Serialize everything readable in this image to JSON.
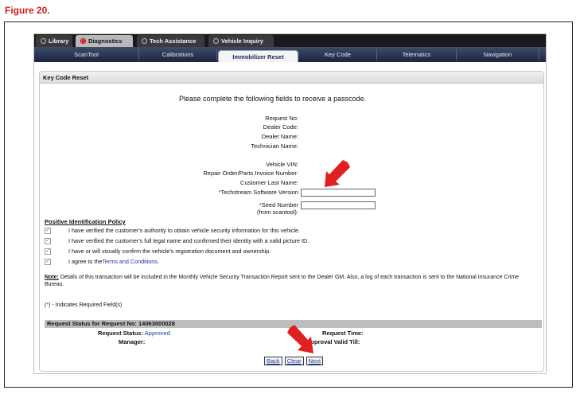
{
  "figure": {
    "title": "Figure 20."
  },
  "top_tabs": [
    {
      "label": "Library",
      "active": false
    },
    {
      "label": "Diagnostics",
      "active": true
    },
    {
      "label": "Tech Assistance",
      "active": false
    },
    {
      "label": "Vehicle Inquiry",
      "active": false
    }
  ],
  "sub_tabs": [
    {
      "label": "ScanTool",
      "active": false
    },
    {
      "label": "Calibrations",
      "active": false
    },
    {
      "label": "Immobilizer Reset",
      "active": true
    },
    {
      "label": "Key Code",
      "active": false
    },
    {
      "label": "Telematics",
      "active": false
    },
    {
      "label": "Navigation",
      "active": false
    }
  ],
  "panel": {
    "title": "Key Code Reset"
  },
  "form": {
    "intro": "Please complete the following fields to receive a passcode.",
    "labels": {
      "request_no": "Request No:",
      "dealer_code": "Dealer Code:",
      "dealer_name": "Dealer Name:",
      "technician_name": "Technician Name:",
      "vehicle_vin": "Vehicle VIN:",
      "repair_order": "Repair Order/Parts Invoice Number:",
      "customer_last_name": "Customer Last Name:",
      "techstream_version": "Techstream Software Version",
      "seed_number": "Seed Number",
      "seed_number_sub": "(from scantool):"
    },
    "required_mark": "*",
    "techstream_value": "",
    "seed_value": ""
  },
  "policy": {
    "title": "Positive Identification Policy",
    "items": [
      {
        "text": "I have verified the customer's authority to obtain vehicle security information for this vehicle.",
        "checked": true
      },
      {
        "text": "I have verified the customer's full legal name and confirmed their identity with a valid picture ID.",
        "checked": true
      },
      {
        "text": "I have or will visually confirm the vehicle's registration document and ownership.",
        "checked": true
      },
      {
        "text_prefix": "I agree to the ",
        "link": "Terms and Conditions",
        "text_suffix": ".",
        "checked": true
      }
    ],
    "check_glyph": "✓"
  },
  "note": {
    "label": "Note:",
    "text": " Details of this transaction will be included in the Monthly Vehicle Security Transaction Report sent to the Dealer GM. Also, a log of each transaction is sent to the National Insurance Crime Bureau."
  },
  "legend": {
    "open": "(",
    "mark": "*",
    "close": ") - Indicates Required Field(s)"
  },
  "status": {
    "header": "Request Status for Request No: 14063000028",
    "request_status_label": "Request Status:",
    "request_status_value": "Approved",
    "manager_label": "Manager:",
    "request_time_label": "Request Time:",
    "approval_valid_label": "Approval Valid Till:"
  },
  "buttons": {
    "back": "Back",
    "clear": "Clear",
    "next": "Next"
  },
  "colors": {
    "figure_title": "#d21e1e",
    "arrow": "#e02020",
    "nav_bg": "#1b2440"
  }
}
